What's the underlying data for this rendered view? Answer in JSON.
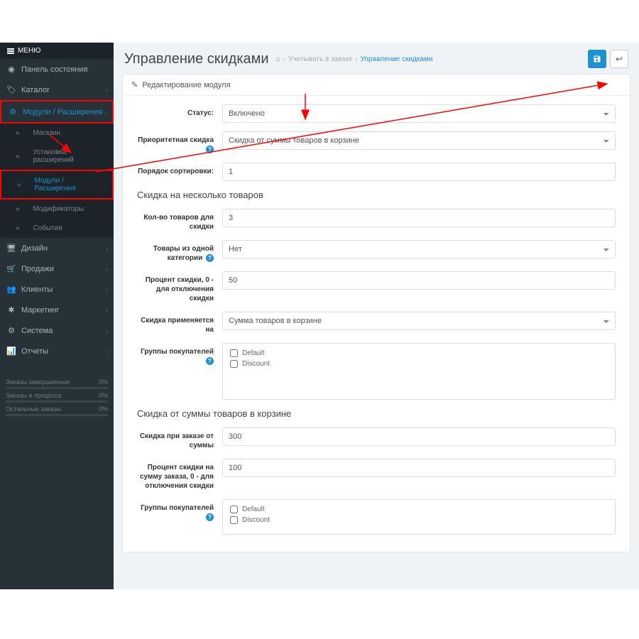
{
  "menu": {
    "header": "МЕНЮ",
    "dashboard": "Панель состояния",
    "catalog": "Каталог",
    "modules": "Модули / Расширения",
    "sub": {
      "shop": "Магазин",
      "install": "Установка расширений",
      "modules": "Модули / Расширения",
      "modifiers": "Модификаторы",
      "events": "События"
    },
    "design": "Дизайн",
    "sales": "Продажи",
    "customers": "Клиенты",
    "marketing": "Маркетинг",
    "system": "Система",
    "reports": "Отчеты"
  },
  "stats": {
    "completed": {
      "label": "Заказы завершенные",
      "value": "0%"
    },
    "progress": {
      "label": "Заказы в процессе",
      "value": "0%"
    },
    "other": {
      "label": "Остальные заказы",
      "value": "0%"
    }
  },
  "page": {
    "title": "Управление скидками",
    "breadcrumb_mid": "Учитывать в заказе",
    "breadcrumb_last": "Управление скидками"
  },
  "panel": {
    "title": "Редактирование модуля"
  },
  "form": {
    "status_label": "Статус:",
    "status_value": "Включено",
    "priority_label": "Приоритетная скидка",
    "priority_value": "Скидка от суммы товаров в корзине",
    "sort_label": "Порядок сортировки:",
    "sort_value": "1",
    "section_multi": "Скидка на несколько товаров",
    "qty_label": "Кол-во товаров для скидки",
    "qty_value": "3",
    "same_cat_label": "Товары из одной категории",
    "same_cat_value": "Нет",
    "pct_label": "Процент скидки, 0 - для отключения скидки",
    "pct_value": "50",
    "applies_label": "Скидка применяется на",
    "applies_value": "Сумма товаров в корзине",
    "groups_label": "Группы покупателей",
    "group_default": "Default",
    "group_discount": "Discount",
    "section_cart": "Скидка от суммы товаров в корзине",
    "from_sum_label": "Скидка при заказе от суммы",
    "from_sum_value": "300",
    "cart_pct_label": "Процент скидки на сумму заказа, 0 - для отключения скидки",
    "cart_pct_value": "100"
  }
}
